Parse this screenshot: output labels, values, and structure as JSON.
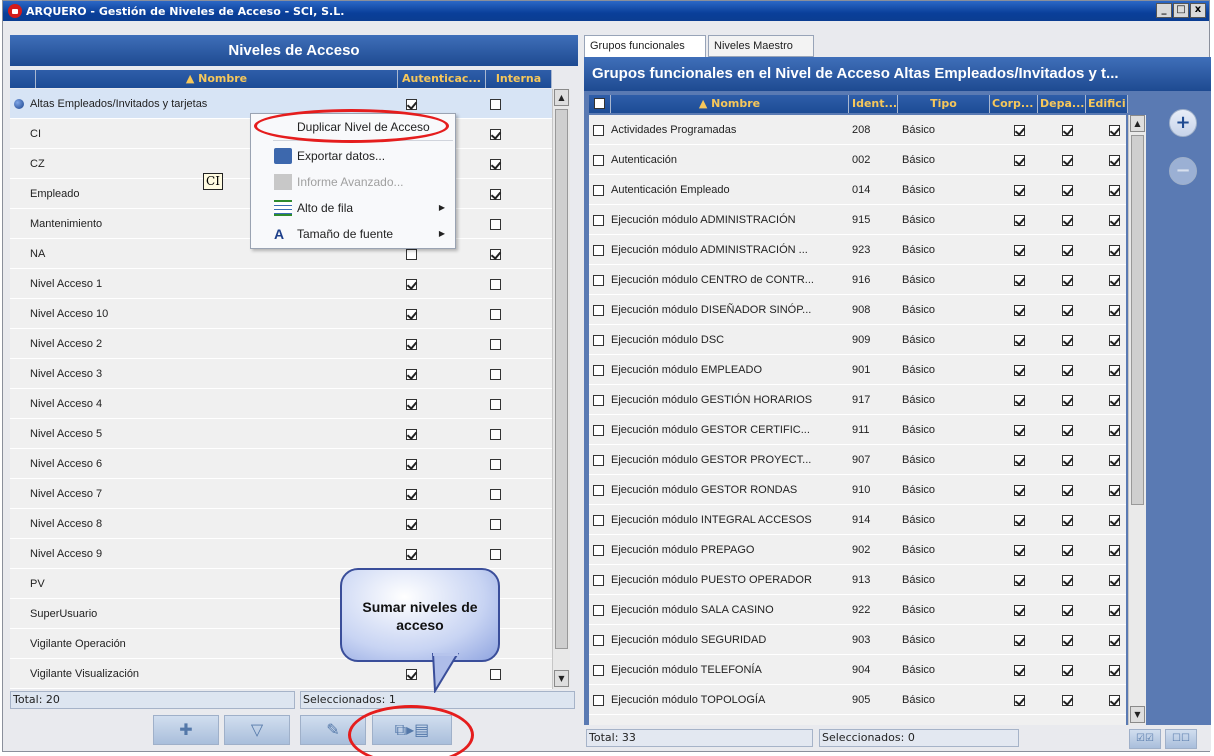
{
  "window": {
    "title": "ARQUERO - Gestión de Niveles de Acceso - SCI, S.L.",
    "btn_min": "_",
    "btn_max": "□",
    "btn_close": "x"
  },
  "left": {
    "header": "Niveles de Acceso",
    "columns": {
      "nombre": "▲ Nombre",
      "autenticacion": "Autenticac...",
      "interna": "Interna"
    },
    "rows": [
      {
        "name": "Altas Empleados/Invitados y tarjetas",
        "auth": true,
        "interna": false,
        "selected": true
      },
      {
        "name": "CI",
        "auth": null,
        "interna": true
      },
      {
        "name": "CZ",
        "auth": null,
        "interna": true
      },
      {
        "name": "Empleado",
        "auth": null,
        "interna": true
      },
      {
        "name": "Mantenimiento",
        "auth": null,
        "interna": false
      },
      {
        "name": "NA",
        "auth": false,
        "interna": true
      },
      {
        "name": "Nivel Acceso 1",
        "auth": true,
        "interna": false
      },
      {
        "name": "Nivel Acceso 10",
        "auth": true,
        "interna": false
      },
      {
        "name": "Nivel Acceso 2",
        "auth": true,
        "interna": false
      },
      {
        "name": "Nivel Acceso 3",
        "auth": true,
        "interna": false
      },
      {
        "name": "Nivel Acceso 4",
        "auth": true,
        "interna": false
      },
      {
        "name": "Nivel Acceso 5",
        "auth": true,
        "interna": false
      },
      {
        "name": "Nivel Acceso 6",
        "auth": true,
        "interna": false
      },
      {
        "name": "Nivel Acceso 7",
        "auth": true,
        "interna": false
      },
      {
        "name": "Nivel Acceso 8",
        "auth": true,
        "interna": false
      },
      {
        "name": "Nivel Acceso 9",
        "auth": true,
        "interna": false
      },
      {
        "name": "PV",
        "auth": null,
        "interna": null
      },
      {
        "name": "SuperUsuario",
        "auth": null,
        "interna": null
      },
      {
        "name": "Vigilante Operación",
        "auth": null,
        "interna": null
      },
      {
        "name": "Vigilante Visualización",
        "auth": true,
        "interna": false
      }
    ],
    "total": "Total: 20",
    "selected": "Seleccionados: 1",
    "tooltip": "CI"
  },
  "context_menu": {
    "items": [
      {
        "label": "Duplicar Nivel de Acceso",
        "disabled": false,
        "submenu": false,
        "icon": ""
      },
      {
        "label": "Exportar datos...",
        "disabled": false,
        "submenu": false,
        "icon": "save-icon"
      },
      {
        "label": "Informe Avanzado...",
        "disabled": true,
        "submenu": false,
        "icon": "report-icon"
      },
      {
        "label": "Alto de fila",
        "disabled": false,
        "submenu": true,
        "icon": "row-height-icon"
      },
      {
        "label": "Tamaño de fuente",
        "disabled": false,
        "submenu": true,
        "icon": "font-size-icon"
      }
    ]
  },
  "callout": {
    "text": "Sumar niveles de acceso"
  },
  "right": {
    "tabs": [
      "Grupos funcionales",
      "Niveles Maestro"
    ],
    "header": "Grupos funcionales en el Nivel de Acceso Altas Empleados/Invitados y t...",
    "columns": {
      "nombre": "▲ Nombre",
      "ident": "Ident...",
      "tipo": "Tipo",
      "corp": "Corp...",
      "depa": "Depa...",
      "edif": "Edifici"
    },
    "rows": [
      {
        "name": "Actividades Programadas",
        "id": "208",
        "tipo": "Básico"
      },
      {
        "name": "Autenticación",
        "id": "002",
        "tipo": "Básico"
      },
      {
        "name": "Autenticación Empleado",
        "id": "014",
        "tipo": "Básico"
      },
      {
        "name": "Ejecución módulo ADMINISTRACIÓN",
        "id": "915",
        "tipo": "Básico"
      },
      {
        "name": "Ejecución módulo ADMINISTRACIÓN ...",
        "id": "923",
        "tipo": "Básico"
      },
      {
        "name": "Ejecución módulo CENTRO de CONTR...",
        "id": "916",
        "tipo": "Básico"
      },
      {
        "name": "Ejecución módulo DISEÑADOR SINÓP...",
        "id": "908",
        "tipo": "Básico"
      },
      {
        "name": "Ejecución módulo DSC",
        "id": "909",
        "tipo": "Básico"
      },
      {
        "name": "Ejecución módulo EMPLEADO",
        "id": "901",
        "tipo": "Básico"
      },
      {
        "name": "Ejecución módulo GESTIÓN HORARIOS",
        "id": "917",
        "tipo": "Básico"
      },
      {
        "name": "Ejecución módulo GESTOR CERTIFIC...",
        "id": "911",
        "tipo": "Básico"
      },
      {
        "name": "Ejecución módulo GESTOR PROYECT...",
        "id": "907",
        "tipo": "Básico"
      },
      {
        "name": "Ejecución módulo GESTOR RONDAS",
        "id": "910",
        "tipo": "Básico"
      },
      {
        "name": "Ejecución módulo INTEGRAL ACCESOS",
        "id": "914",
        "tipo": "Básico"
      },
      {
        "name": "Ejecución módulo PREPAGO",
        "id": "902",
        "tipo": "Básico"
      },
      {
        "name": "Ejecución módulo PUESTO OPERADOR",
        "id": "913",
        "tipo": "Básico"
      },
      {
        "name": "Ejecución módulo SALA CASINO",
        "id": "922",
        "tipo": "Básico"
      },
      {
        "name": "Ejecución módulo SEGURIDAD",
        "id": "903",
        "tipo": "Básico"
      },
      {
        "name": "Ejecución módulo TELEFONÍA",
        "id": "904",
        "tipo": "Básico"
      },
      {
        "name": "Ejecución módulo TOPOLOGÍA",
        "id": "905",
        "tipo": "Básico"
      }
    ],
    "total": "Total: 33",
    "selected": "Seleccionados: 0",
    "add_btn": "+",
    "remove_btn": "−"
  }
}
